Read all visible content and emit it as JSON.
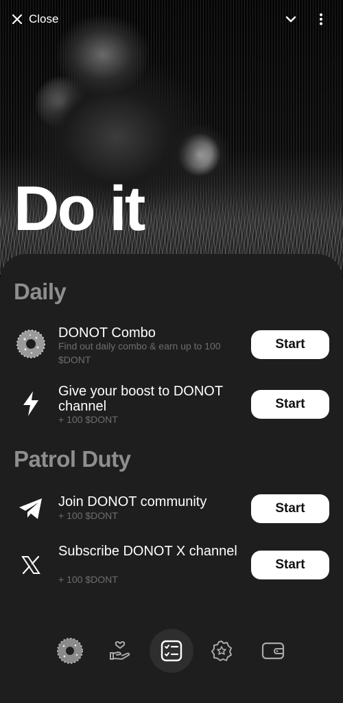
{
  "topbar": {
    "close_label": "Close",
    "close_icon": "close-icon",
    "collapse_icon": "chevron-down-icon",
    "menu_icon": "more-vertical-icon"
  },
  "hero": {
    "title": "Do it"
  },
  "sections": {
    "daily": {
      "title": "Daily",
      "tasks": [
        {
          "icon": "donut-icon",
          "title": "DONOT Combo",
          "subtitle": "Find out daily combo & earn up to 100 $DONT",
          "button": "Start"
        },
        {
          "icon": "lightning-icon",
          "title": "Give your boost to DONOT channel",
          "subtitle": "+ 100 $DONT",
          "button": "Start"
        }
      ]
    },
    "patrol": {
      "title": "Patrol Duty",
      "tasks": [
        {
          "icon": "telegram-icon",
          "title": "Join DONOT community",
          "subtitle": "+ 100 $DONT",
          "button": "Start"
        },
        {
          "icon": "x-logo-icon",
          "title": "Subscribe DONOT X channel",
          "subtitle": "+ 100 $DONT",
          "button": "Start"
        }
      ]
    }
  },
  "nav": {
    "items": [
      "donut-icon",
      "hand-heart-icon",
      "task-list-icon",
      "badge-icon",
      "wallet-icon"
    ],
    "active_index": 2
  },
  "colors": {
    "sheet_bg": "#1e1e1e",
    "section_title": "#8e8e8e",
    "subtitle": "#6e6e6e",
    "button_bg": "#ffffff",
    "button_text": "#111111"
  }
}
